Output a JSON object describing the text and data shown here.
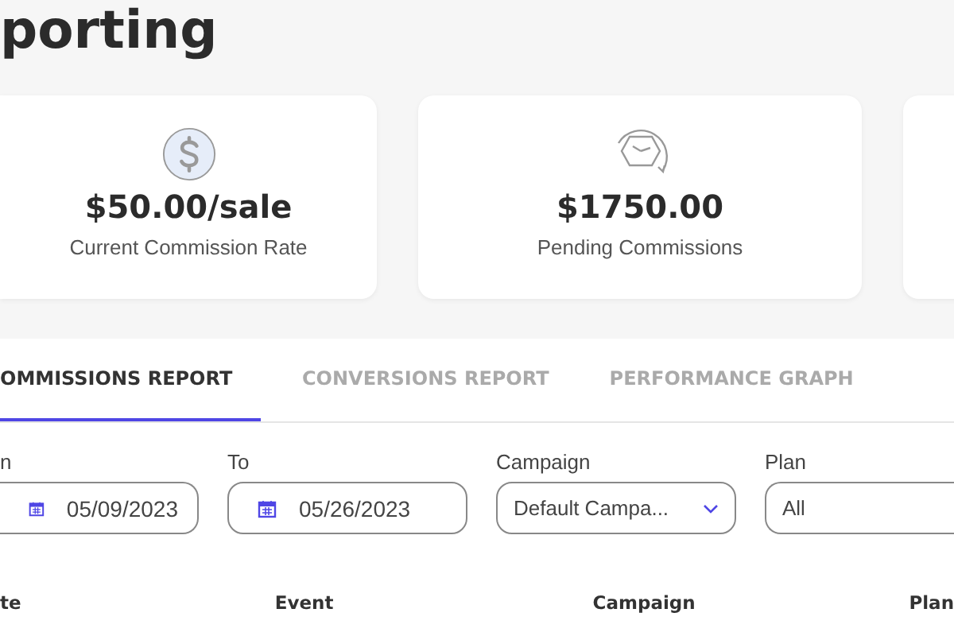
{
  "page": {
    "title": "porting"
  },
  "stats": [
    {
      "kind": "rate",
      "value": "$50.00/sale",
      "label": "Current Commission Rate"
    },
    {
      "kind": "pending",
      "value": "$1750.00",
      "label": "Pending Commissions"
    }
  ],
  "tabs": [
    {
      "label": "OMMISSIONS REPORT",
      "selected": true
    },
    {
      "label": "CONVERSIONS REPORT",
      "selected": false
    },
    {
      "label": "PERFORMANCE GRAPH",
      "selected": false
    }
  ],
  "filters": [
    {
      "kind": "date",
      "label": "n",
      "value": "05/09/2023"
    },
    {
      "kind": "date",
      "label": "To",
      "value": "05/26/2023"
    },
    {
      "kind": "select",
      "label": "Campaign",
      "value": "Default Campa..."
    },
    {
      "kind": "select_plain",
      "label": "Plan",
      "value": "All"
    }
  ],
  "table": {
    "columns": [
      "te",
      "Event",
      "Campaign",
      "Plan"
    ]
  }
}
